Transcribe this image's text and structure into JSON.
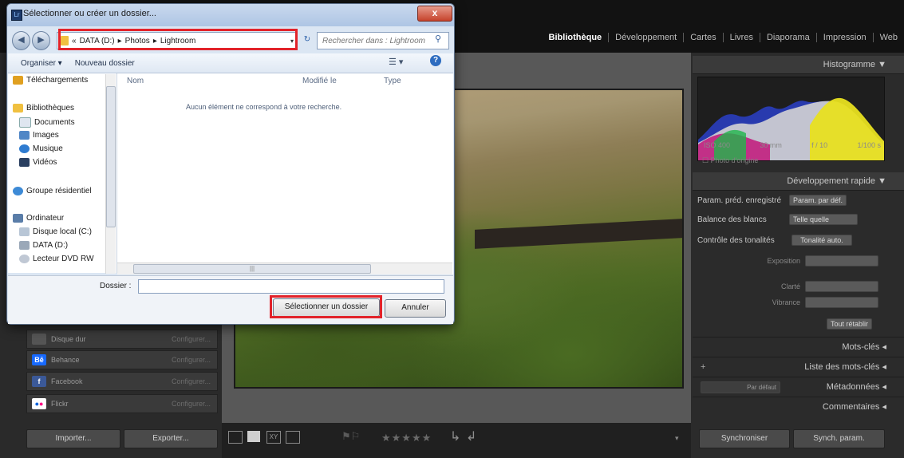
{
  "lightroom": {
    "modules": [
      "Bibliothèque",
      "Développement",
      "Cartes",
      "Livres",
      "Diaporama",
      "Impression",
      "Web"
    ],
    "histogram": {
      "title": "Histogramme",
      "iso": "ISO 400",
      "focal": "30 mm",
      "aperture": "f / 10",
      "shutter": "1/100 s",
      "original_label": "Photo d'origine"
    },
    "quick_develop": {
      "title": "Développement rapide",
      "preset_label": "Param. préd. enregistré",
      "preset_value": "Param. par déf.",
      "wb_label": "Balance des blancs",
      "wb_value": "Telle quelle",
      "tone_label": "Contrôle des tonalités",
      "tone_btn": "Tonalité auto.",
      "exposure_label": "Exposition",
      "clarity_label": "Clarté",
      "vibrance_label": "Vibrance",
      "reset_btn": "Tout rétablir"
    },
    "panels": {
      "keywords": "Mots-clés",
      "keyword_list": "Liste des mots-clés",
      "metadata_preset": "Par défaut",
      "metadata": "Métadonnées",
      "comments": "Commentaires"
    },
    "services": [
      {
        "name": "Disque dur",
        "action": "Configurer..."
      },
      {
        "name": "Behance",
        "action": "Configurer..."
      },
      {
        "name": "Facebook",
        "action": "Configurer..."
      },
      {
        "name": "Flickr",
        "action": "Configurer..."
      }
    ],
    "buttons": {
      "import": "Importer...",
      "export": "Exporter...",
      "sync": "Synchroniser",
      "sync_settings": "Synch. param."
    },
    "stars": "★★★★★"
  },
  "dialog": {
    "title": "Sélectionner ou créer un dossier...",
    "close": "x",
    "breadcrumb": [
      "«",
      "DATA (D:)",
      "▸",
      "Photos",
      "▸",
      "Lightroom"
    ],
    "search_placeholder": "Rechercher dans : Lightroom",
    "toolbar": {
      "organize": "Organiser ▾",
      "new_folder": "Nouveau dossier"
    },
    "nav": [
      "Téléchargements",
      "Bibliothèques",
      "Documents",
      "Images",
      "Musique",
      "Vidéos",
      "Groupe résidentiel",
      "Ordinateur",
      "Disque local (C:)",
      "DATA (D:)",
      "Lecteur DVD RW"
    ],
    "columns": {
      "name": "Nom",
      "modified": "Modifié le",
      "type": "Type"
    },
    "empty_message": "Aucun élément ne correspond à votre recherche.",
    "folder_label": "Dossier :",
    "folder_value": "",
    "select_btn": "Sélectionner un dossier",
    "cancel_btn": "Annuler"
  }
}
